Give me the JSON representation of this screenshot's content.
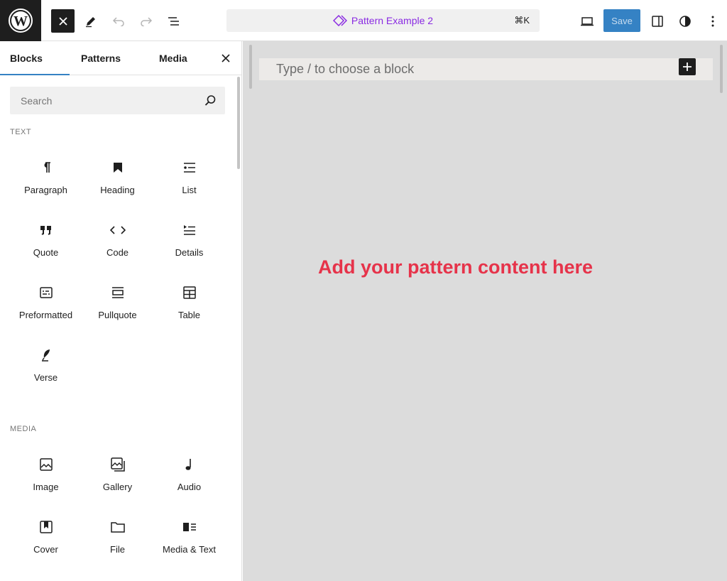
{
  "topbar": {
    "close_label": "Close",
    "command_title": "Pattern Example 2",
    "command_shortcut": "⌘K",
    "save_label": "Save"
  },
  "inserter": {
    "tabs": [
      "Blocks",
      "Patterns",
      "Media"
    ],
    "search_placeholder": "Search",
    "sections": [
      {
        "label": "TEXT",
        "blocks": [
          {
            "label": "Paragraph",
            "icon": "paragraph-icon"
          },
          {
            "label": "Heading",
            "icon": "heading-icon"
          },
          {
            "label": "List",
            "icon": "list-icon"
          },
          {
            "label": "Quote",
            "icon": "quote-icon"
          },
          {
            "label": "Code",
            "icon": "code-icon"
          },
          {
            "label": "Details",
            "icon": "details-icon"
          },
          {
            "label": "Preformatted",
            "icon": "preformatted-icon"
          },
          {
            "label": "Pullquote",
            "icon": "pullquote-icon"
          },
          {
            "label": "Table",
            "icon": "table-icon"
          },
          {
            "label": "Verse",
            "icon": "verse-icon"
          }
        ]
      },
      {
        "label": "MEDIA",
        "blocks": [
          {
            "label": "Image",
            "icon": "image-icon"
          },
          {
            "label": "Gallery",
            "icon": "gallery-icon"
          },
          {
            "label": "Audio",
            "icon": "audio-icon"
          },
          {
            "label": "Cover",
            "icon": "cover-icon"
          },
          {
            "label": "File",
            "icon": "file-icon"
          },
          {
            "label": "Media & Text",
            "icon": "media-text-icon"
          }
        ]
      }
    ]
  },
  "canvas": {
    "appender_placeholder": "Type / to choose a block",
    "message": "Add your pattern content here"
  },
  "colors": {
    "accent": "#3582c4",
    "pattern_purple": "#8a2be2",
    "message_red": "#e6334a"
  }
}
